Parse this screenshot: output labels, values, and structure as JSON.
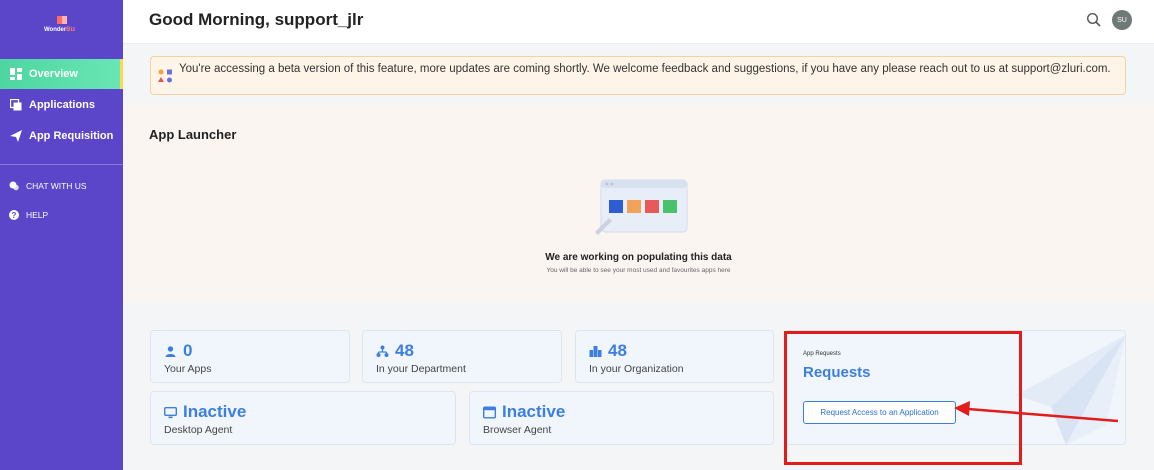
{
  "app": {
    "brand": {
      "part1": "Wonder",
      "part2": "Biz"
    }
  },
  "sidebar": {
    "items": [
      {
        "label": "Overview",
        "icon": "grid-icon",
        "active": true
      },
      {
        "label": "Applications",
        "icon": "window-icon",
        "active": false
      },
      {
        "label": "App Requisition",
        "icon": "paper-plane-icon",
        "active": false
      }
    ],
    "links": [
      {
        "label": "CHAT WITH US",
        "icon": "chat-icon"
      },
      {
        "label": "HELP",
        "icon": "help-icon"
      }
    ]
  },
  "header": {
    "greeting": "Good Morning, support_jlr",
    "avatar_initials": "SU"
  },
  "banner": {
    "message": "You're accessing a beta version of this feature, more updates are coming shortly. We welcome feedback and suggestions, if you have any please reach out to us at support@zluri.com."
  },
  "launcher": {
    "title": "App Launcher",
    "empty_title": "We are working on populating this data",
    "empty_subtitle": "You will be able to see your most used and favourites apps here"
  },
  "stats": [
    {
      "value": "0",
      "label": "Your Apps",
      "icon": "user-icon"
    },
    {
      "value": "48",
      "label": "In your Department",
      "icon": "org-chart-icon"
    },
    {
      "value": "48",
      "label": "In your Organization",
      "icon": "building-icon"
    },
    {
      "value": "Inactive",
      "label": "Desktop Agent",
      "icon": "monitor-icon"
    },
    {
      "value": "Inactive",
      "label": "Browser Agent",
      "icon": "browser-icon"
    }
  ],
  "requests": {
    "small_label": "App Requests",
    "title": "Requests",
    "button_label": "Request Access to an Application"
  },
  "colors": {
    "sidebar": "#5b45c8",
    "active_nav": "#4ed6a0",
    "accent_blue": "#3c7fe0",
    "annotation_red": "#e21b1b",
    "banner_bg": "#fff4e8"
  }
}
